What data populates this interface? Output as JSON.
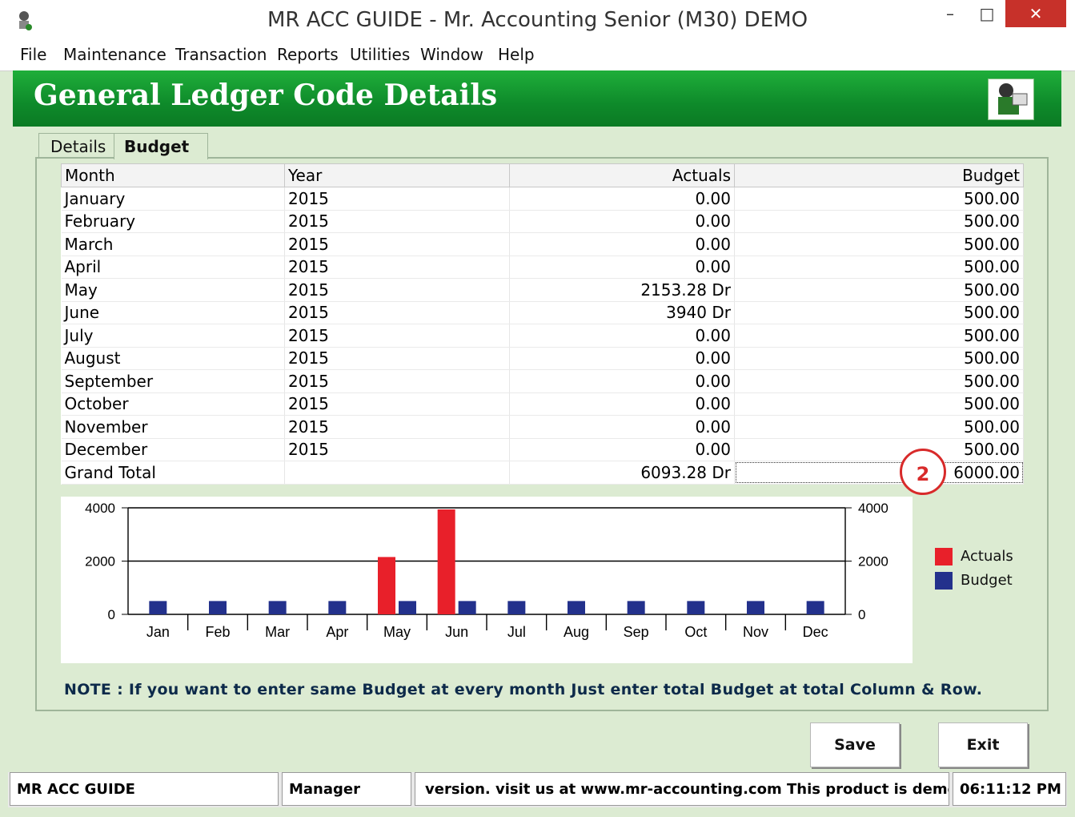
{
  "window": {
    "title": "MR ACC GUIDE - Mr. Accounting Senior (M30) DEMO",
    "minimize": "–",
    "maximize": "□",
    "close": "✕"
  },
  "menu": {
    "file": "File",
    "maintenance": "Maintenance",
    "transaction": "Transaction",
    "reports": "Reports",
    "utilities": "Utilities",
    "window": "Window",
    "help": "Help"
  },
  "header": {
    "title": "General Ledger Code Details"
  },
  "tabs": {
    "details": "Details",
    "budget": "Budget"
  },
  "grid": {
    "headers": {
      "month": "Month",
      "year": "Year",
      "actuals": "Actuals",
      "budget": "Budget"
    },
    "rows": [
      {
        "month": "January",
        "year": "2015",
        "actuals": "0.00",
        "budget": "500.00"
      },
      {
        "month": "February",
        "year": "2015",
        "actuals": "0.00",
        "budget": "500.00"
      },
      {
        "month": "March",
        "year": "2015",
        "actuals": "0.00",
        "budget": "500.00"
      },
      {
        "month": "April",
        "year": "2015",
        "actuals": "0.00",
        "budget": "500.00"
      },
      {
        "month": "May",
        "year": "2015",
        "actuals": "2153.28  Dr",
        "budget": "500.00"
      },
      {
        "month": "June",
        "year": "2015",
        "actuals": "3940  Dr",
        "budget": "500.00"
      },
      {
        "month": "July",
        "year": "2015",
        "actuals": "0.00",
        "budget": "500.00"
      },
      {
        "month": "August",
        "year": "2015",
        "actuals": "0.00",
        "budget": "500.00"
      },
      {
        "month": "September",
        "year": "2015",
        "actuals": "0.00",
        "budget": "500.00"
      },
      {
        "month": "October",
        "year": "2015",
        "actuals": "0.00",
        "budget": "500.00"
      },
      {
        "month": "November",
        "year": "2015",
        "actuals": "0.00",
        "budget": "500.00"
      },
      {
        "month": "December",
        "year": "2015",
        "actuals": "0.00",
        "budget": "500.00"
      }
    ],
    "total": {
      "month": "Grand Total",
      "year": "",
      "actuals": "6093.28 Dr",
      "budget": "6000.00"
    }
  },
  "callout": "2",
  "chart_data": {
    "type": "bar",
    "categories": [
      "Jan",
      "Feb",
      "Mar",
      "Apr",
      "May",
      "Jun",
      "Jul",
      "Aug",
      "Sep",
      "Oct",
      "Nov",
      "Dec"
    ],
    "series": [
      {
        "name": "Actuals",
        "color": "#e8202a",
        "values": [
          0,
          0,
          0,
          0,
          2153.28,
          3940,
          0,
          0,
          0,
          0,
          0,
          0
        ]
      },
      {
        "name": "Budget",
        "color": "#23318c",
        "values": [
          500,
          500,
          500,
          500,
          500,
          500,
          500,
          500,
          500,
          500,
          500,
          500
        ]
      }
    ],
    "ylim": [
      0,
      4000
    ],
    "yticks": [
      0,
      2000,
      4000
    ],
    "legend_position": "right",
    "title": "",
    "xlabel": "",
    "ylabel": ""
  },
  "note": "NOTE : If you want to enter same Budget at every month Just enter total Budget at total Column & Row.",
  "buttons": {
    "save": "Save",
    "exit": "Exit"
  },
  "status": {
    "app": "MR ACC GUIDE",
    "user": "Manager",
    "message": "version.  visit us at www.mr-accounting.com This product is demo",
    "time": "06:11:12 PM"
  }
}
